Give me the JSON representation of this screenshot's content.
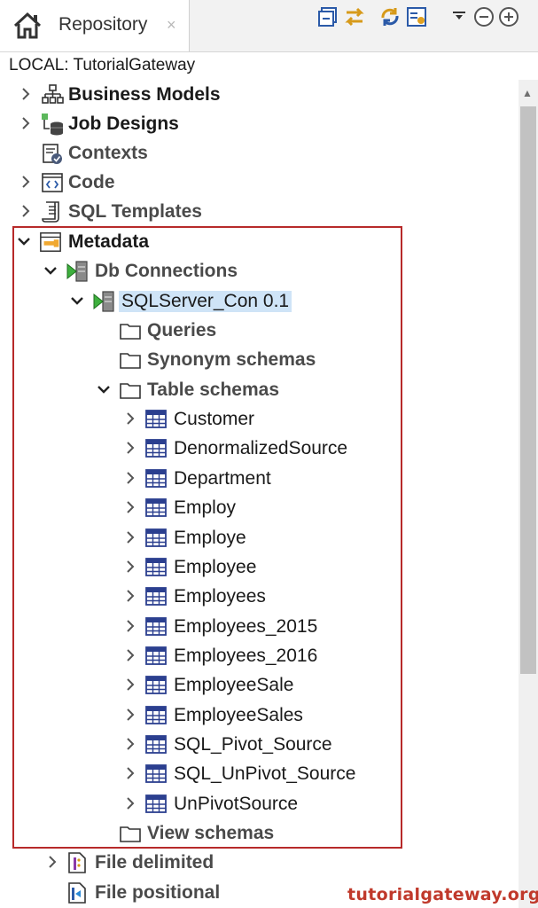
{
  "tab": {
    "title": "Repository",
    "close_glyph": "×"
  },
  "path": "LOCAL: TutorialGateway",
  "tree": {
    "business_models": "Business Models",
    "job_designs": "Job Designs",
    "contexts": "Contexts",
    "code": "Code",
    "sql_templates": "SQL Templates",
    "metadata": "Metadata",
    "db_connections": "Db Connections",
    "sqlserver_con": "SQLServer_Con 0.1",
    "queries": "Queries",
    "synonym_schemas": "Synonym schemas",
    "table_schemas": "Table schemas",
    "tables": [
      "Customer",
      "DenormalizedSource",
      "Department",
      "Employ",
      "Employe",
      "Employee",
      "Employees",
      "Employees_2015",
      "Employees_2016",
      "EmployeeSale",
      "EmployeeSales",
      "SQL_Pivot_Source",
      "SQL_UnPivot_Source",
      "UnPivotSource"
    ],
    "view_schemas": "View schemas",
    "file_delimited": "File delimited",
    "file_positional": "File positional"
  },
  "watermark": "tutorialgateway.org",
  "colors": {
    "highlight": "#b72a2a",
    "selection": "#cfe4f7",
    "watermark": "#c0392b"
  }
}
